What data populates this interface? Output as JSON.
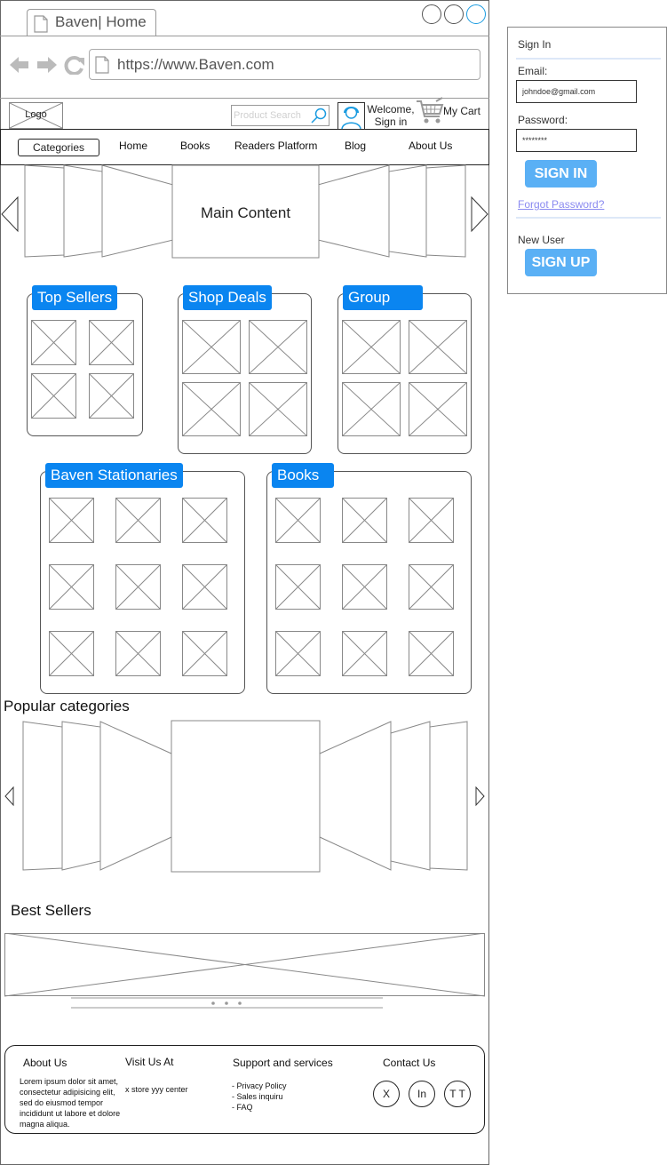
{
  "browser": {
    "tab_title": "Baven| Home",
    "url": "https://www.Baven.com"
  },
  "header": {
    "logo_label": "Logo",
    "search_placeholder": "Product Search",
    "welcome_line1": "Welcome,",
    "welcome_line2": "Sign in",
    "cart_label": "My Cart"
  },
  "nav": {
    "items": [
      "Categories",
      "Home",
      "Books",
      "Readers Platform",
      "Blog",
      "About Us"
    ]
  },
  "hero": {
    "label": "Main Content"
  },
  "sections": {
    "top_sellers": "Top Sellers",
    "shop_deals": "Shop Deals",
    "group": "Group",
    "stationaries": "Baven Stationaries",
    "books": "Books"
  },
  "popular": {
    "title": "Popular categories"
  },
  "best_sellers": {
    "title": "Best Sellers"
  },
  "footer": {
    "about_title": "About Us",
    "about_text": "Lorem ipsum dolor sit amet, consectetur adipisicing elit, sed do eiusmod tempor incididunt ut labore et dolore magna aliqua.",
    "visit_title": "Visit Us At",
    "visit_text": "x store yyy center",
    "support_title": "Support and services",
    "support_items": [
      "- Privacy Policy",
      "- Sales inquiru",
      "- FAQ"
    ],
    "contact_title": "Contact Us",
    "social": [
      "X",
      "In",
      "T T"
    ]
  },
  "signin": {
    "title": "Sign In",
    "email_label": "Email:",
    "email_value": "johndoe@gmail.com",
    "password_label": "Password:",
    "password_value": "********",
    "signin_button": "SIGN IN",
    "forgot": "Forgot Password?",
    "new_user": "New User",
    "signup_button": "SIGN UP"
  },
  "colors": {
    "accent": "#0a85f0",
    "button": "#5ab0f5",
    "link": "#8a8af0"
  }
}
